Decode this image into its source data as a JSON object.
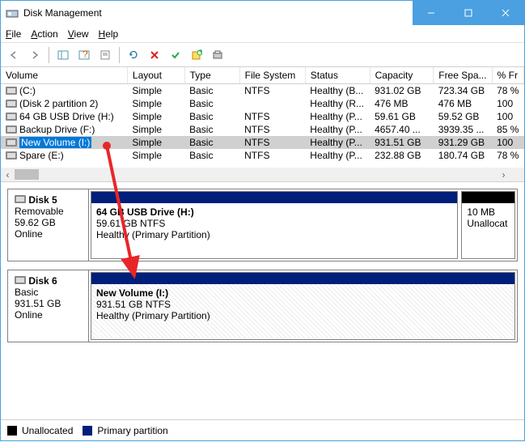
{
  "window": {
    "title": "Disk Management"
  },
  "menu": {
    "file": "File",
    "action": "Action",
    "view": "View",
    "help": "Help"
  },
  "columns": [
    "Volume",
    "Layout",
    "Type",
    "File System",
    "Status",
    "Capacity",
    "Free Spa...",
    "% Fr"
  ],
  "volumes": [
    {
      "name": "(C:)",
      "layout": "Simple",
      "type": "Basic",
      "fs": "NTFS",
      "status": "Healthy (B...",
      "capacity": "931.02 GB",
      "free": "723.34 GB",
      "pct": "78 %"
    },
    {
      "name": "(Disk 2 partition 2)",
      "layout": "Simple",
      "type": "Basic",
      "fs": "",
      "status": "Healthy (R...",
      "capacity": "476 MB",
      "free": "476 MB",
      "pct": "100"
    },
    {
      "name": "64 GB USB Drive (H:)",
      "layout": "Simple",
      "type": "Basic",
      "fs": "NTFS",
      "status": "Healthy (P...",
      "capacity": "59.61 GB",
      "free": "59.52 GB",
      "pct": "100"
    },
    {
      "name": "Backup Drive (F:)",
      "layout": "Simple",
      "type": "Basic",
      "fs": "NTFS",
      "status": "Healthy (P...",
      "capacity": "4657.40 ...",
      "free": "3939.35 ...",
      "pct": "85 %"
    },
    {
      "name": "New Volume (I:)",
      "layout": "Simple",
      "type": "Basic",
      "fs": "NTFS",
      "status": "Healthy (P...",
      "capacity": "931.51 GB",
      "free": "931.29 GB",
      "pct": "100"
    },
    {
      "name": "Spare (E:)",
      "layout": "Simple",
      "type": "Basic",
      "fs": "NTFS",
      "status": "Healthy (P...",
      "capacity": "232.88 GB",
      "free": "180.74 GB",
      "pct": "78 %"
    }
  ],
  "disk5": {
    "name": "Disk 5",
    "kind": "Removable",
    "size": "59.62 GB",
    "state": "Online",
    "vol": {
      "title": "64 GB USB Drive  (H:)",
      "line1": "59.61 GB NTFS",
      "line2": "Healthy (Primary Partition)"
    },
    "ua": {
      "line1": "10 MB",
      "line2": "Unallocat"
    }
  },
  "disk6": {
    "name": "Disk 6",
    "kind": "Basic",
    "size": "931.51 GB",
    "state": "Online",
    "vol": {
      "title": "New Volume  (I:)",
      "line1": "931.51 GB NTFS",
      "line2": "Healthy (Primary Partition)"
    }
  },
  "legend": {
    "unalloc": "Unallocated",
    "primary": "Primary partition"
  }
}
